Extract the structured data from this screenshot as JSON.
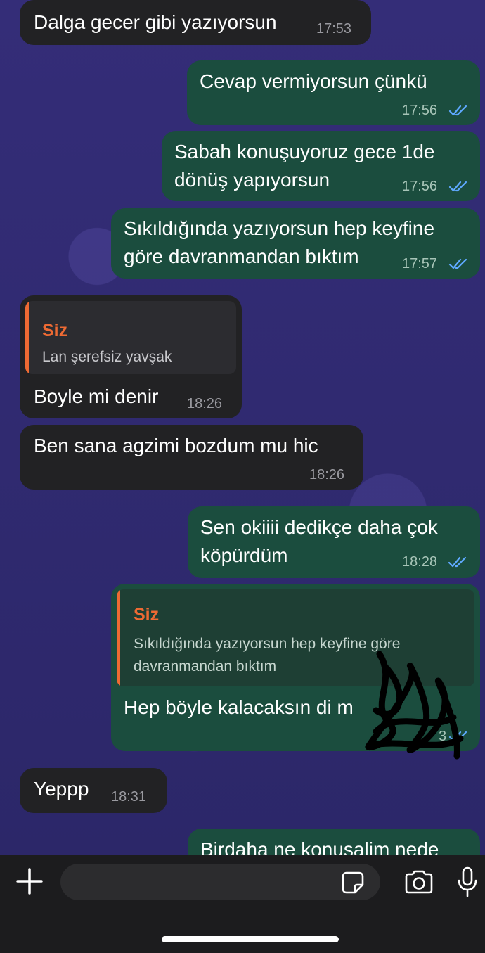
{
  "colors": {
    "incoming_bubble": "#222224",
    "outgoing_bubble": "#1b4d3e",
    "reply_accent": "#ee6a33",
    "read_ticks": "#5fa9ff",
    "wallpaper": "#2f2a6b"
  },
  "messages": [
    {
      "direction": "incoming",
      "text": "Dalga gecer gibi yazıyorsun",
      "time": "17:53"
    },
    {
      "direction": "outgoing",
      "text": "Cevap vermiyorsun çünkü",
      "time": "17:56",
      "status": "read"
    },
    {
      "direction": "outgoing",
      "lines": [
        "Sabah konuşuyoruz gece 1de",
        "dönüş yapıyorsun"
      ],
      "time": "17:56",
      "status": "read"
    },
    {
      "direction": "outgoing",
      "lines": [
        "Sıkıldığında yazıyorsun hep keyfine",
        "göre davranmandan bıktım"
      ],
      "time": "17:57",
      "status": "read"
    },
    {
      "direction": "incoming",
      "reply": {
        "author": "Siz",
        "text": "Lan şerefsiz yavşak"
      },
      "text": "Boyle mi denir",
      "time": "18:26"
    },
    {
      "direction": "incoming",
      "text": "Ben sana agzimi bozdum mu hic",
      "time": "18:26"
    },
    {
      "direction": "outgoing",
      "lines": [
        "Sen okiiii dedikçe daha çok",
        "köpürdüm"
      ],
      "time": "18:28",
      "status": "read"
    },
    {
      "direction": "outgoing",
      "reply": {
        "author": "Siz",
        "lines": [
          "Sıkıldığında yazıyorsun hep keyfine göre",
          "davranmandan bıktım"
        ]
      },
      "text": "Hep böyle kalacaksın di m",
      "time": "3",
      "status": "read"
    },
    {
      "direction": "incoming",
      "text": "Yeppp",
      "time": "18:31"
    },
    {
      "direction": "outgoing",
      "text": "Birdaha ne konusalim nede",
      "partial": true
    }
  ],
  "composer": {
    "plus_icon": "plus-icon",
    "sticker_icon": "sticker-icon",
    "camera_icon": "camera-icon",
    "mic_icon": "microphone-icon"
  }
}
